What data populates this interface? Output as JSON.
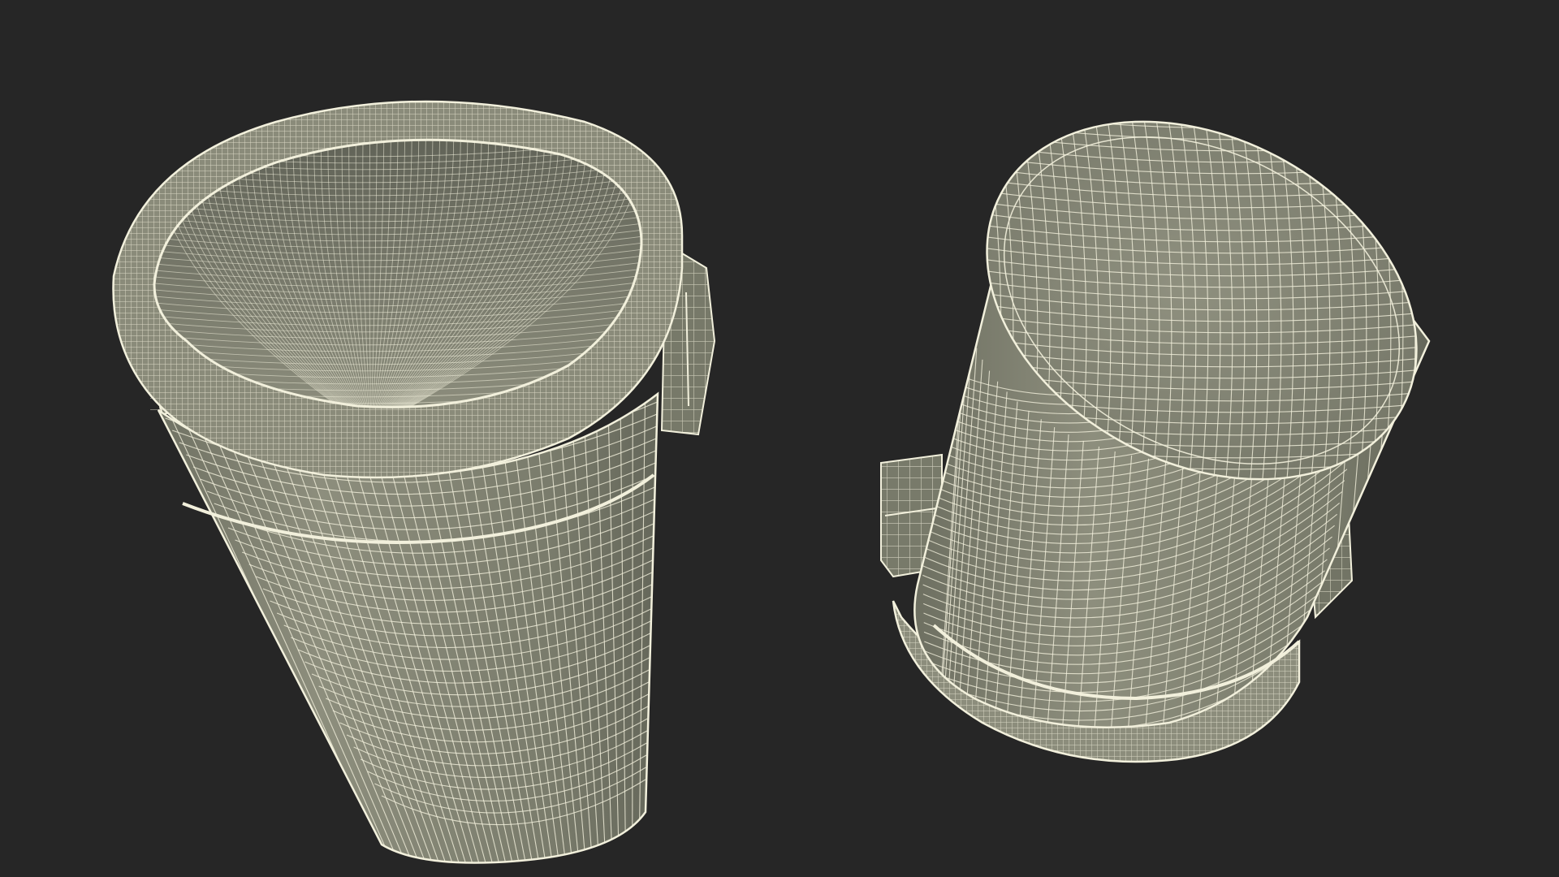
{
  "scene": {
    "background_color": "#262626",
    "wire_color": "#f2f0dc",
    "surface_color": "#7c7e6e",
    "surface_light": "#9a9b8a",
    "surface_dark": "#5e6054",
    "models": [
      {
        "name": "trash-can-upright-with-liner"
      },
      {
        "name": "trash-can-inverted-bottom-view"
      }
    ]
  }
}
